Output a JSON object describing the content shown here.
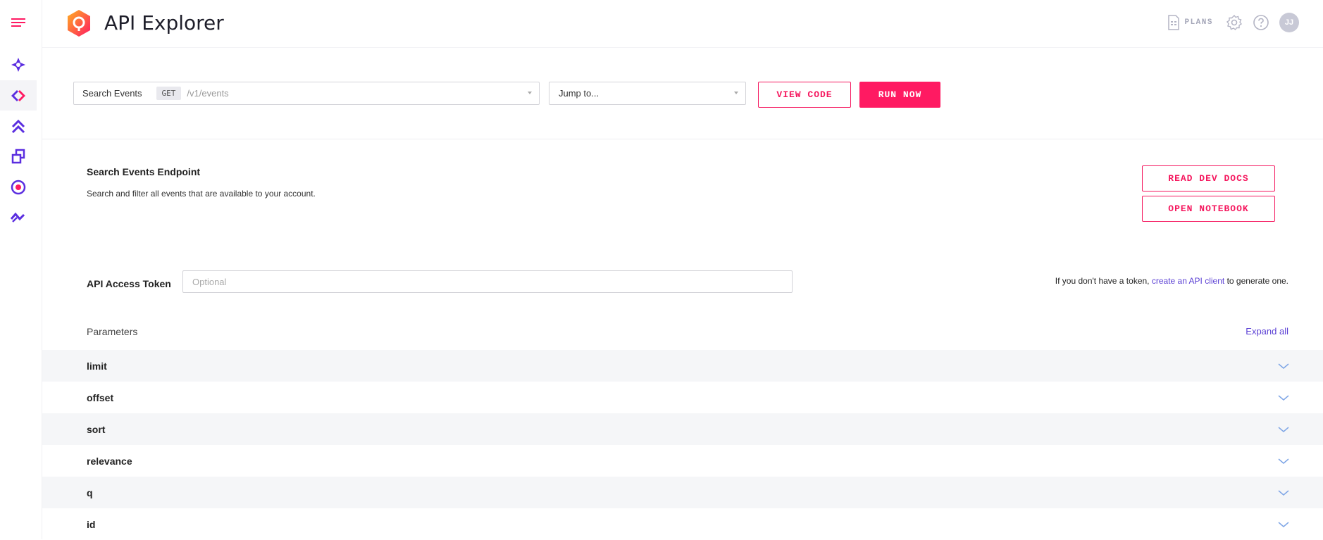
{
  "header": {
    "title": "API Explorer",
    "plans_label": "PLANS",
    "avatar_initials": "JJ"
  },
  "toolbar": {
    "endpoint_select": {
      "name": "Search Events",
      "method": "GET",
      "path": "/v1/events"
    },
    "jump_select": {
      "value": "Jump to..."
    },
    "view_code_label": "VIEW CODE",
    "run_now_label": "RUN NOW"
  },
  "endpoint": {
    "title": "Search Events Endpoint",
    "description": "Search and filter all events that are available to your account.",
    "read_docs_label": "READ DEV DOCS",
    "open_notebook_label": "OPEN NOTEBOOK"
  },
  "token": {
    "label": "API Access Token",
    "placeholder": "Optional",
    "note_prefix": "If you don't have a token,",
    "note_link": "create an API client",
    "note_suffix": "to generate one."
  },
  "parameters": {
    "label": "Parameters",
    "expand_all_label": "Expand all",
    "items": [
      "limit",
      "offset",
      "sort",
      "relevance",
      "q",
      "id"
    ]
  },
  "colors": {
    "accent": "#ff1a62",
    "link": "#5a3fd4",
    "sidebar_icon": "#5b2ee0",
    "chevron": "#7fa6e6"
  },
  "sidebar": {
    "items": [
      {
        "icon": "menu-icon"
      },
      {
        "icon": "compass-star-icon"
      },
      {
        "icon": "api-explorer-icon",
        "active": true
      },
      {
        "icon": "double-chevron-up-icon"
      },
      {
        "icon": "stack-copy-icon"
      },
      {
        "icon": "target-icon"
      },
      {
        "icon": "wave-line-icon"
      }
    ]
  }
}
